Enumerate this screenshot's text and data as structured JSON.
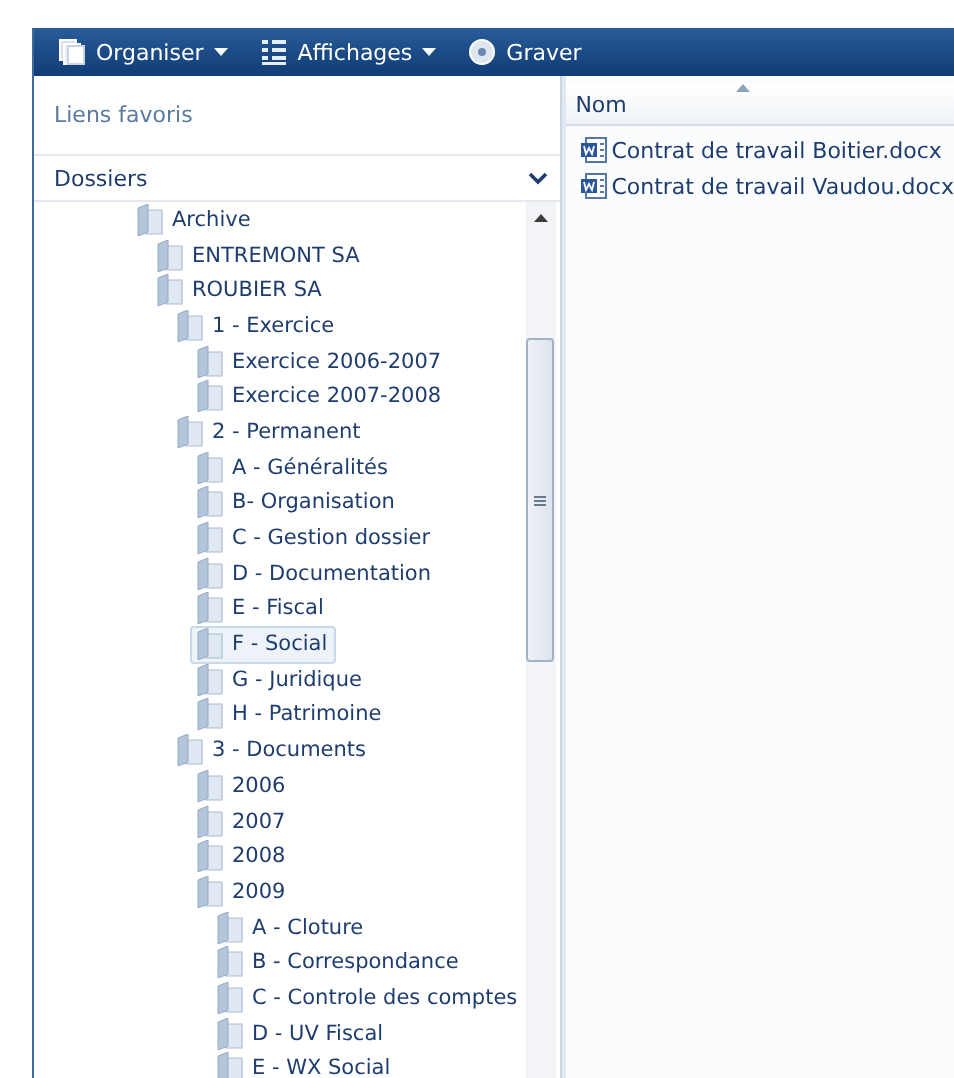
{
  "toolbar": {
    "buttons": [
      {
        "kind": "organize",
        "label": "Organiser",
        "dropdown": true
      },
      {
        "kind": "views",
        "label": "Affichages",
        "dropdown": true
      },
      {
        "kind": "burn",
        "label": "Graver",
        "dropdown": false
      }
    ]
  },
  "navigation": {
    "favorites_label": "Liens favoris",
    "folders_label": "Dossiers",
    "tree": [
      {
        "label": "Archive",
        "selected": false,
        "children": [
          {
            "label": "ENTREMONT SA",
            "selected": false
          },
          {
            "label": "ROUBIER SA",
            "selected": false,
            "children": [
              {
                "label": "1 - Exercice",
                "selected": false,
                "children": [
                  {
                    "label": "Exercice 2006-2007",
                    "selected": false
                  },
                  {
                    "label": "Exercice 2007-2008",
                    "selected": false
                  }
                ]
              },
              {
                "label": "2 - Permanent",
                "selected": false,
                "children": [
                  {
                    "label": "A - Généralités",
                    "selected": false
                  },
                  {
                    "label": "B- Organisation",
                    "selected": false
                  },
                  {
                    "label": "C - Gestion dossier",
                    "selected": false
                  },
                  {
                    "label": "D - Documentation",
                    "selected": false
                  },
                  {
                    "label": "E - Fiscal",
                    "selected": false
                  },
                  {
                    "label": "F - Social",
                    "selected": true
                  },
                  {
                    "label": "G - Juridique",
                    "selected": false
                  },
                  {
                    "label": "H - Patrimoine",
                    "selected": false
                  }
                ]
              },
              {
                "label": "3 - Documents",
                "selected": false,
                "children": [
                  {
                    "label": "2006",
                    "selected": false
                  },
                  {
                    "label": "2007",
                    "selected": false
                  },
                  {
                    "label": "2008",
                    "selected": false
                  },
                  {
                    "label": "2009",
                    "selected": false,
                    "children": [
                      {
                        "label": "A - Cloture",
                        "selected": false
                      },
                      {
                        "label": "B - Correspondance",
                        "selected": false
                      },
                      {
                        "label": "C - Controle des comptes",
                        "selected": false
                      },
                      {
                        "label": "D - UV Fiscal",
                        "selected": false
                      },
                      {
                        "label": "E - WX Social",
                        "selected": false
                      }
                    ]
                  }
                ]
              }
            ]
          }
        ]
      }
    ]
  },
  "files": {
    "columns": [
      "Nom"
    ],
    "rows": [
      {
        "name": "Contrat de travail Boitier.docx"
      },
      {
        "name": "Contrat de travail Vaudou.docx"
      }
    ]
  }
}
